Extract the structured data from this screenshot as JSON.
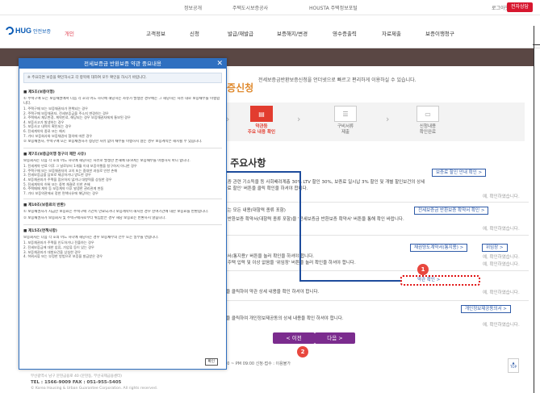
{
  "topbar": {
    "links": [
      "정보공개",
      "주택도시보증공사",
      "HOUSTA 주택정보포털",
      "로그아웃"
    ],
    "lang_button": "전자상담"
  },
  "nav": {
    "logo_brand": "HUG",
    "logo_sub": "안전보증",
    "personal": "개인",
    "menu": [
      "고객정보",
      "신청",
      "발급/재발급",
      "보증해지/변경",
      "영수증출력",
      "자료제출",
      "보증이행청구"
    ]
  },
  "hero": {
    "title": "보증신청",
    "desc": "전세보증금반환보증신청을 언더넷으로 빠르고 편리하게 이용하실 수 있습니다."
  },
  "steps": [
    {
      "label": "약관등\n주요 내용 확인",
      "icon": "document-icon",
      "active": true
    },
    {
      "label": "구비서류\n제출",
      "icon": "upload-icon",
      "active": false
    },
    {
      "label": "신청내용\n확인완료",
      "icon": "monitor-icon",
      "active": false
    }
  ],
  "section_title": "등 주요사항",
  "rows": [
    {
      "button": "보증료 할인 안내 확인 >",
      "text": "로 보증 관련 기소득을 등 사회배려계층 30% LTV 할인 30%, 보증료 일시납 3% 할인 및 개별 할인보건의 상세",
      "text2": "'보증료 할인' 버튼을 클릭 확인을 하셔야 합니다.",
      "check": "예, 확인하였습니다."
    },
    {
      "button": "전세보증금 반환보증 확약서 확인 >",
      "text": "이 있는 모든 내용(대항력 종류 포함)",
      "text2": "증금 반환보증 확약서(대항력 종류 포함)을 '전세보증금 반환보증 확약서' 버튼을 통해 확인 바랍니다.",
      "check": "예, 확인하였습니다."
    },
    {
      "button": "채권양도계약서(통지용) >",
      "button2": "위임장 >",
      "text": "'계약서(통지용)' 버튼을 눌러 확인을 하셔야 합니다.",
      "text2": "통해 주택 입력 및 이상 없음을 '위임장' 버튼을 눌러 확인을 하셔야 합니다.",
      "check": "예, 확인하였습니다."
    },
    {
      "button": "약관 확인 >",
      "text": "버튼을 클릭하여 약관 상세 내용을 확인 하셔야 합니다.",
      "check": "예, 확인하였습니다."
    },
    {
      "button": "개인정보제공동의서 >",
      "text": "버튼을 클릭하여 개인정보제공동의 상세 내용을 확인 하셔야 합니다.",
      "check": "예, 확인하였습니다."
    }
  ],
  "nav_buttons": {
    "prev": "< 이전",
    "next": "다음 >"
  },
  "markers": [
    "1",
    "2"
  ],
  "footer": {
    "hours": "09:00 ~ PM 09:00  신청·접수 : 이용불가",
    "top": "TOP",
    "address": "부산광역시 남구 문현금융로 40 (문현동, 부산국제금융센터)",
    "tel": "TEL : 1566-9009   FAX : 051-955-5405",
    "copyright": "© Korea Housing & Urban Guarantee Corporation. All rights reserved."
  },
  "modal": {
    "title": "전세보증금 반환보증 약관 중요내용",
    "close": "✕",
    "notice": "※ 주요다면 보증을 확인하시고 각 항목에 대하여 모두 확인을 하시기 바랍니다.",
    "sections": [
      {
        "heading": "■ 제5조(보증이행)",
        "para": "① 주택구매 또는 보증채권에서 다음 각 호의 어느 하나에 해당하는 사유가 발생한 경우에는 그 해당하는 사유 대로 보증채무를 이행합니다.",
        "lines": [
          "1. 주택구매 또는 보증채권자가 면책되는 경우",
          "2. 주택구매 보증채권자, 전세보증금을 주소지 변경하는 경우",
          "3. 주택에서 채무변경, 계약만료, 해당되는 경우 보증채권자에게 통보된 경우",
          "4. 보증사고가 발생하는 경우",
          "5. 보증사고 내역이 확인되는 경우",
          "6. 전세계약의 종료 또는 해지",
          "7. 기타 보증회사와 보증채권자 협의에 따른 경우"
        ],
        "para2": "② 보증채권자, 주택구매 또는 보증채권자가 정당한 사유 없이 채무를 이행하지 않는 경우 보증계약은 해지될 수 있습니다."
      },
      {
        "heading": "■ 제7조(보증금이행 청구의 제한 사유)",
        "para": "보증회사는 다음 각 호의 어느 하나에 해당하는 사유로 발생한 손해에 대하여는 보증채무를 이행하지 아니 합니다.",
        "lines": [
          "1. 전세계약 만료 이후 그 날로부터 1개월 이내 보증이행을 청구하지 아니한 경우",
          "2. 주택구매 또는 보증채권자의 고의 또는 중대한 과실로 인한 손해",
          "3. 전세보증금을 담보로 제공하거나 양도한 경우",
          "4. 보증채권자가 주택을 점유하지 않거나 대항력을 상실한 경우",
          "5. 전세계약의 허위 또는 중복 체결로 인한 손해",
          "6. 주택매매 계약 등 보증계약 이후 발생한 권리관계 변동",
          "7. 기타 보증약관에서 정한 면책사유에 해당하는 경우"
        ],
        "para2": ""
      },
      {
        "heading": "■ 제10조(보증료의 반환)",
        "para": "① 보증채권자가 지급한 보증료는 주택구매 기간이 만료되거나 보증계약이 해지된 경우 잔여기간에 대한 보증료를 반환합니다.",
        "lines": [],
        "para2": "② 보증채권자가 보증회사 및 주택구매자로부터 위임받은 경우 해당 보증료는 반환하지 않습니다."
      },
      {
        "heading": "■ 제15조(면책사항)",
        "para": "보증회사는 다음 각 호의 어느 하나에 해당하는 경우 보증채무의 전부 또는 일부를 면합니다.",
        "lines": [
          "1. 보증채권자가 주택을 인도하거나 전출하는 경우",
          "2. 전세보증금에 대한 압류, 가압류 등이 있는 경우",
          "3. 보증채권자가 대항요건을 상실한 경우",
          "4. 허위서류 또는 부정한 방법으로 보증을 발급받은 경우"
        ],
        "para2": ""
      }
    ],
    "confirm": "확인"
  }
}
